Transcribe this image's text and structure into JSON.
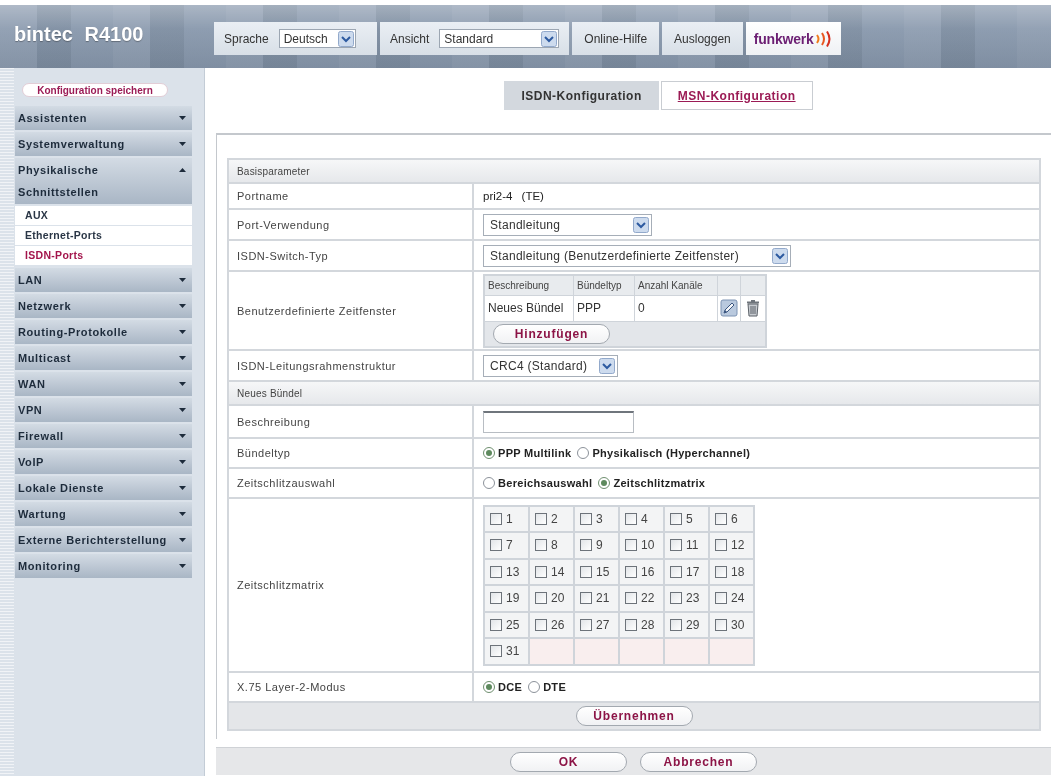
{
  "header": {
    "logo": "bintec R4100",
    "language": {
      "label": "Sprache",
      "value": "Deutsch"
    },
    "view": {
      "label": "Ansicht",
      "value": "Standard"
    },
    "links": [
      "Online-Hilfe",
      "Ausloggen"
    ],
    "brand": "funkwerk"
  },
  "sidebar": {
    "save_button": "Konfiguration speichern",
    "items": [
      {
        "label": "Assistenten",
        "expanded": false
      },
      {
        "label": "Systemverwaltung",
        "expanded": false
      },
      {
        "label": "Physikalische Schnittstellen",
        "expanded": true,
        "children": [
          {
            "label": "AUX",
            "selected": false
          },
          {
            "label": "Ethernet-Ports",
            "selected": false
          },
          {
            "label": "ISDN-Ports",
            "selected": true
          }
        ]
      },
      {
        "label": "LAN",
        "expanded": false
      },
      {
        "label": "Netzwerk",
        "expanded": false
      },
      {
        "label": "Routing-Protokolle",
        "expanded": false
      },
      {
        "label": "Multicast",
        "expanded": false
      },
      {
        "label": "WAN",
        "expanded": false
      },
      {
        "label": "VPN",
        "expanded": false
      },
      {
        "label": "Firewall",
        "expanded": false
      },
      {
        "label": "VoIP",
        "expanded": false
      },
      {
        "label": "Lokale Dienste",
        "expanded": false
      },
      {
        "label": "Wartung",
        "expanded": false
      },
      {
        "label": "Externe Berichterstellung",
        "expanded": false
      },
      {
        "label": "Monitoring",
        "expanded": false
      }
    ]
  },
  "tabs": [
    {
      "label": "ISDN-Konfiguration",
      "selected": true
    },
    {
      "label": "MSN-Konfiguration",
      "selected": false
    }
  ],
  "form": {
    "sections": [
      {
        "title": "Basisparameter",
        "rows": [
          {
            "kind": "text",
            "label": "Portname",
            "value": "pri2-4 (TE)"
          },
          {
            "kind": "select",
            "label": "Port-Verwendung",
            "value": "Standleitung"
          },
          {
            "kind": "select",
            "label": "ISDN-Switch-Typ",
            "value": "Standleitung (Benutzerdefinierte Zeitfenster)"
          },
          {
            "kind": "table",
            "label": "Benutzerdefinierte Zeitfenster",
            "columns": [
              "Beschreibung",
              "Bündeltyp",
              "Anzahl Kanäle"
            ],
            "rows": [
              [
                "Neues Bündel",
                "PPP",
                "0"
              ]
            ],
            "add_button": "Hinzufügen"
          },
          {
            "kind": "select",
            "label": "ISDN-Leitungsrahmenstruktur",
            "value": "CRC4 (Standard)"
          }
        ]
      },
      {
        "title": "Neues Bündel",
        "rows": [
          {
            "kind": "input",
            "label": "Beschreibung"
          },
          {
            "kind": "radio",
            "label": "Bündeltyp",
            "options": [
              {
                "label": "PPP Multilink",
                "selected": true
              },
              {
                "label": "Physikalisch (Hyperchannel)",
                "selected": false
              }
            ]
          },
          {
            "kind": "radio",
            "label": "Zeitschlitzauswahl",
            "options": [
              {
                "label": "Bereichsauswahl",
                "selected": false
              },
              {
                "label": "Zeitschlitzmatrix",
                "selected": true
              }
            ]
          },
          {
            "kind": "checkbox_grid",
            "label": "Zeitschlitzmatrix",
            "items": [
              {
                "label": "1",
                "checked": false
              },
              {
                "label": "2",
                "checked": false
              },
              {
                "label": "3",
                "checked": false
              },
              {
                "label": "4",
                "checked": false
              },
              {
                "label": "5",
                "checked": false
              },
              {
                "label": "6",
                "checked": false
              },
              {
                "label": "7",
                "checked": false
              },
              {
                "label": "8",
                "checked": false
              },
              {
                "label": "9",
                "checked": false
              },
              {
                "label": "10",
                "checked": false
              },
              {
                "label": "11",
                "checked": false
              },
              {
                "label": "12",
                "checked": false
              },
              {
                "label": "13",
                "checked": false
              },
              {
                "label": "14",
                "checked": false
              },
              {
                "label": "15",
                "checked": false
              },
              {
                "label": "16",
                "checked": false
              },
              {
                "label": "17",
                "checked": false
              },
              {
                "label": "18",
                "checked": false
              },
              {
                "label": "19",
                "checked": false
              },
              {
                "label": "20",
                "checked": false
              },
              {
                "label": "21",
                "checked": false
              },
              {
                "label": "22",
                "checked": false
              },
              {
                "label": "23",
                "checked": false
              },
              {
                "label": "24",
                "checked": false
              },
              {
                "label": "25",
                "checked": false
              },
              {
                "label": "26",
                "checked": false
              },
              {
                "label": "27",
                "checked": false
              },
              {
                "label": "28",
                "checked": false
              },
              {
                "label": "29",
                "checked": false
              },
              {
                "label": "30",
                "checked": false
              },
              {
                "label": "31",
                "checked": false
              }
            ]
          },
          {
            "kind": "radio",
            "label": "X.75 Layer-2-Modus",
            "options": [
              {
                "label": "DCE",
                "selected": true
              },
              {
                "label": "DTE",
                "selected": false
              }
            ]
          }
        ]
      }
    ],
    "apply_button": "Übernehmen"
  },
  "footer": {
    "buttons": [
      "OK",
      "Abbrechen"
    ]
  }
}
